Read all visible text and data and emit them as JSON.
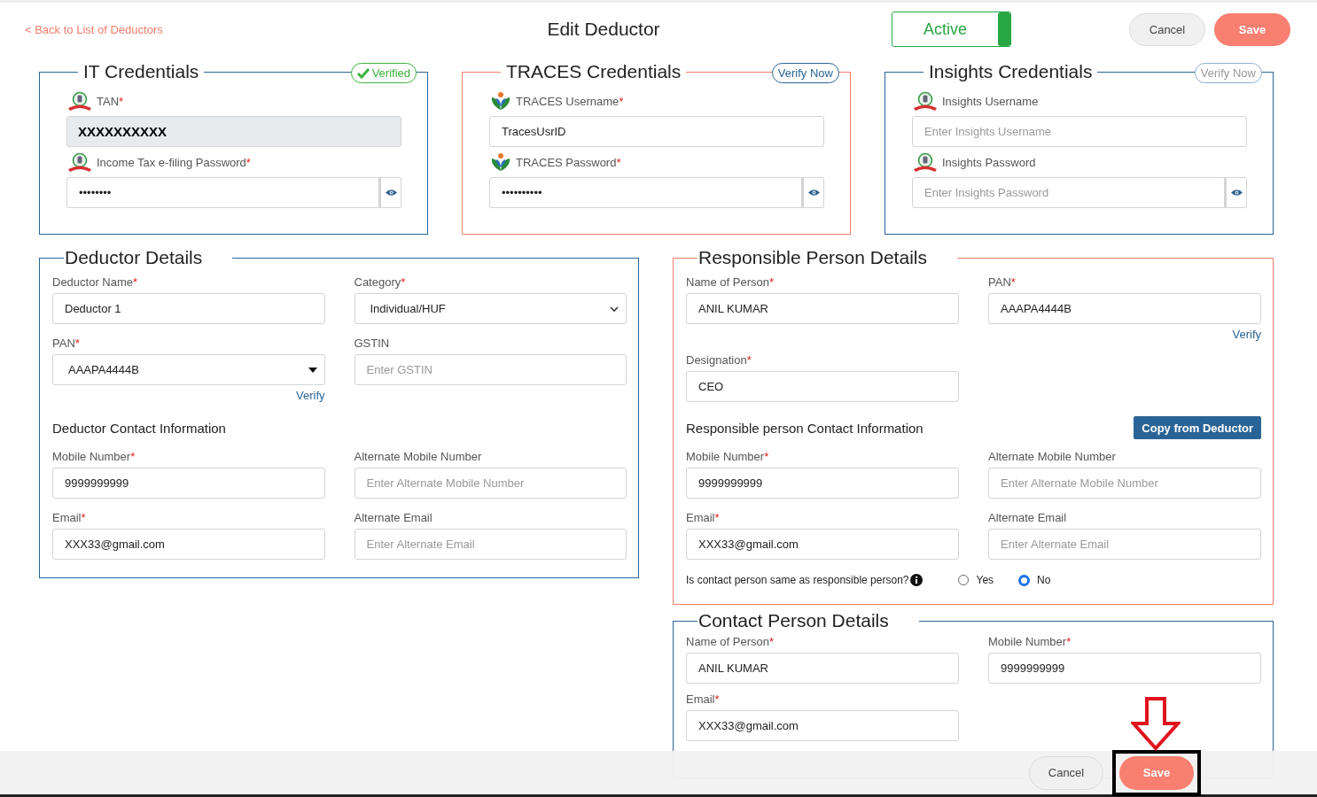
{
  "header": {
    "back_link": "< Back to List of Deductors",
    "title": "Edit Deductor",
    "status_toggle": {
      "label": "Active",
      "on": true
    },
    "buttons": [
      {
        "label": "Cancel",
        "kind": "secondary"
      },
      {
        "label": "Save",
        "kind": "primary"
      }
    ]
  },
  "credentials": [
    {
      "title": "IT Credentials",
      "kind": "income-tax",
      "highlighted": false,
      "badge": {
        "label": "Verified",
        "kind": "verified",
        "disabled": false
      },
      "fields": [
        {
          "label": "TAN",
          "mark": "*",
          "kind": "readonly",
          "value": "XXXXXXXXXX"
        },
        {
          "label": "Income Tax e-filing Password",
          "mark": "*",
          "kind": "password",
          "value": "••••••••"
        }
      ]
    },
    {
      "title": "TRACES Credentials",
      "kind": "traces",
      "highlighted": true,
      "badge": {
        "label": "Verify Now",
        "kind": "verify",
        "disabled": false
      },
      "fields": [
        {
          "label": "TRACES Username",
          "mark": "*",
          "kind": "text",
          "value": "TracesUsrID"
        },
        {
          "label": "TRACES Password",
          "mark": "*",
          "kind": "password",
          "value": "••••••••••"
        }
      ]
    },
    {
      "title": "Insights Credentials",
      "kind": "income-tax",
      "highlighted": false,
      "badge": {
        "label": "Verify Now",
        "kind": "verify",
        "disabled": true
      },
      "fields": [
        {
          "label": "Insights Username",
          "kind": "text",
          "placeholder": "Enter Insights Username"
        },
        {
          "label": "Insights Password",
          "kind": "password",
          "placeholder": "Enter Insights Password"
        }
      ]
    }
  ],
  "deductor": {
    "title": "Deductor Details",
    "highlighted": false,
    "fields": [
      {
        "label": "Deductor Name",
        "mark": "*",
        "kind": "text",
        "value": "Deductor 1"
      },
      {
        "label": "Category",
        "mark": "*",
        "kind": "select",
        "value": "Individual/HUF"
      },
      {
        "label": "PAN",
        "mark": "*",
        "kind": "dropdown",
        "value": "AAAPA4444B",
        "link": "Verify"
      },
      {
        "label": "GSTIN",
        "kind": "text",
        "placeholder": "Enter GSTIN"
      }
    ],
    "contact_heading": "Deductor Contact Information",
    "contact_fields": [
      {
        "label": "Mobile Number",
        "mark": "*",
        "kind": "text",
        "value": "9999999999"
      },
      {
        "label": "Alternate Mobile Number",
        "kind": "text",
        "placeholder": "Enter Alternate Mobile Number"
      },
      {
        "label": "Email",
        "mark": "*",
        "kind": "text",
        "value": "XXX33@gmail.com"
      },
      {
        "label": "Alternate Email",
        "kind": "text",
        "placeholder": "Enter Alternate Email"
      }
    ]
  },
  "responsible": {
    "title": "Responsible Person Details",
    "highlighted": true,
    "fields": [
      {
        "label": "Name of Person",
        "mark": "*",
        "kind": "text",
        "value": "ANIL KUMAR"
      },
      {
        "label": "PAN",
        "mark": "*",
        "kind": "text",
        "value": "AAAPA4444B",
        "link": "Verify"
      },
      {
        "label": "Designation",
        "mark": "*",
        "kind": "text",
        "value": "CEO"
      }
    ],
    "contact_heading": "Responsible person Contact Information",
    "copy_button": "Copy from Deductor",
    "contact_fields": [
      {
        "label": "Mobile Number",
        "mark": "*",
        "kind": "text",
        "value": "9999999999"
      },
      {
        "label": "Alternate Mobile Number",
        "kind": "text",
        "placeholder": "Enter Alternate Mobile Number"
      },
      {
        "label": "Email",
        "mark": "*",
        "kind": "text",
        "value": "XXX33@gmail.com"
      },
      {
        "label": "Alternate Email",
        "kind": "text",
        "placeholder": "Enter Alternate Email"
      }
    ],
    "question": {
      "text": "Is contact person same as responsible person?",
      "options": [
        {
          "label": "Yes",
          "selected": false
        },
        {
          "label": "No",
          "selected": true
        }
      ]
    }
  },
  "contact": {
    "title": "Contact Person Details",
    "highlighted": false,
    "fields": [
      {
        "label": "Name of Person",
        "mark": "*",
        "kind": "text",
        "value": "ANIL KUMAR"
      },
      {
        "label": "Mobile Number",
        "mark": "*",
        "kind": "text",
        "value": "9999999999"
      },
      {
        "label": "Email",
        "mark": "*",
        "kind": "text",
        "value": "XXX33@gmail.com"
      }
    ]
  },
  "footer": {
    "buttons": [
      {
        "label": "Cancel",
        "kind": "secondary"
      },
      {
        "label": "Save",
        "kind": "primary"
      }
    ]
  }
}
